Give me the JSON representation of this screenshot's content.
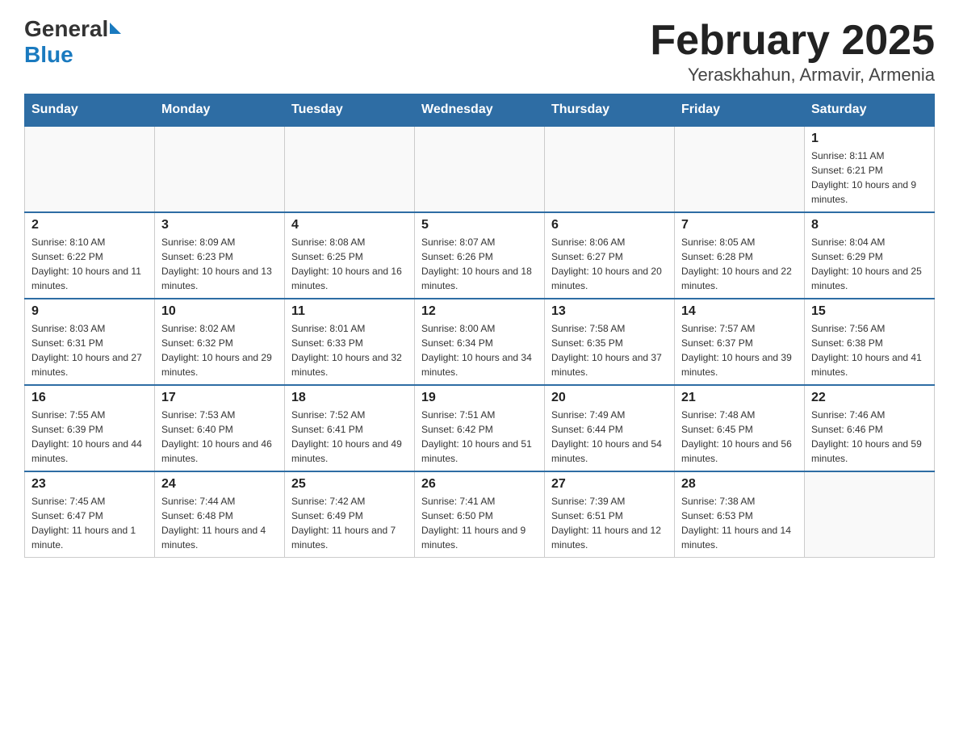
{
  "logo": {
    "general": "General",
    "blue": "Blue"
  },
  "title": "February 2025",
  "location": "Yeraskhahun, Armavir, Armenia",
  "days_of_week": [
    "Sunday",
    "Monday",
    "Tuesday",
    "Wednesday",
    "Thursday",
    "Friday",
    "Saturday"
  ],
  "weeks": [
    [
      {
        "day": "",
        "info": ""
      },
      {
        "day": "",
        "info": ""
      },
      {
        "day": "",
        "info": ""
      },
      {
        "day": "",
        "info": ""
      },
      {
        "day": "",
        "info": ""
      },
      {
        "day": "",
        "info": ""
      },
      {
        "day": "1",
        "info": "Sunrise: 8:11 AM\nSunset: 6:21 PM\nDaylight: 10 hours and 9 minutes."
      }
    ],
    [
      {
        "day": "2",
        "info": "Sunrise: 8:10 AM\nSunset: 6:22 PM\nDaylight: 10 hours and 11 minutes."
      },
      {
        "day": "3",
        "info": "Sunrise: 8:09 AM\nSunset: 6:23 PM\nDaylight: 10 hours and 13 minutes."
      },
      {
        "day": "4",
        "info": "Sunrise: 8:08 AM\nSunset: 6:25 PM\nDaylight: 10 hours and 16 minutes."
      },
      {
        "day": "5",
        "info": "Sunrise: 8:07 AM\nSunset: 6:26 PM\nDaylight: 10 hours and 18 minutes."
      },
      {
        "day": "6",
        "info": "Sunrise: 8:06 AM\nSunset: 6:27 PM\nDaylight: 10 hours and 20 minutes."
      },
      {
        "day": "7",
        "info": "Sunrise: 8:05 AM\nSunset: 6:28 PM\nDaylight: 10 hours and 22 minutes."
      },
      {
        "day": "8",
        "info": "Sunrise: 8:04 AM\nSunset: 6:29 PM\nDaylight: 10 hours and 25 minutes."
      }
    ],
    [
      {
        "day": "9",
        "info": "Sunrise: 8:03 AM\nSunset: 6:31 PM\nDaylight: 10 hours and 27 minutes."
      },
      {
        "day": "10",
        "info": "Sunrise: 8:02 AM\nSunset: 6:32 PM\nDaylight: 10 hours and 29 minutes."
      },
      {
        "day": "11",
        "info": "Sunrise: 8:01 AM\nSunset: 6:33 PM\nDaylight: 10 hours and 32 minutes."
      },
      {
        "day": "12",
        "info": "Sunrise: 8:00 AM\nSunset: 6:34 PM\nDaylight: 10 hours and 34 minutes."
      },
      {
        "day": "13",
        "info": "Sunrise: 7:58 AM\nSunset: 6:35 PM\nDaylight: 10 hours and 37 minutes."
      },
      {
        "day": "14",
        "info": "Sunrise: 7:57 AM\nSunset: 6:37 PM\nDaylight: 10 hours and 39 minutes."
      },
      {
        "day": "15",
        "info": "Sunrise: 7:56 AM\nSunset: 6:38 PM\nDaylight: 10 hours and 41 minutes."
      }
    ],
    [
      {
        "day": "16",
        "info": "Sunrise: 7:55 AM\nSunset: 6:39 PM\nDaylight: 10 hours and 44 minutes."
      },
      {
        "day": "17",
        "info": "Sunrise: 7:53 AM\nSunset: 6:40 PM\nDaylight: 10 hours and 46 minutes."
      },
      {
        "day": "18",
        "info": "Sunrise: 7:52 AM\nSunset: 6:41 PM\nDaylight: 10 hours and 49 minutes."
      },
      {
        "day": "19",
        "info": "Sunrise: 7:51 AM\nSunset: 6:42 PM\nDaylight: 10 hours and 51 minutes."
      },
      {
        "day": "20",
        "info": "Sunrise: 7:49 AM\nSunset: 6:44 PM\nDaylight: 10 hours and 54 minutes."
      },
      {
        "day": "21",
        "info": "Sunrise: 7:48 AM\nSunset: 6:45 PM\nDaylight: 10 hours and 56 minutes."
      },
      {
        "day": "22",
        "info": "Sunrise: 7:46 AM\nSunset: 6:46 PM\nDaylight: 10 hours and 59 minutes."
      }
    ],
    [
      {
        "day": "23",
        "info": "Sunrise: 7:45 AM\nSunset: 6:47 PM\nDaylight: 11 hours and 1 minute."
      },
      {
        "day": "24",
        "info": "Sunrise: 7:44 AM\nSunset: 6:48 PM\nDaylight: 11 hours and 4 minutes."
      },
      {
        "day": "25",
        "info": "Sunrise: 7:42 AM\nSunset: 6:49 PM\nDaylight: 11 hours and 7 minutes."
      },
      {
        "day": "26",
        "info": "Sunrise: 7:41 AM\nSunset: 6:50 PM\nDaylight: 11 hours and 9 minutes."
      },
      {
        "day": "27",
        "info": "Sunrise: 7:39 AM\nSunset: 6:51 PM\nDaylight: 11 hours and 12 minutes."
      },
      {
        "day": "28",
        "info": "Sunrise: 7:38 AM\nSunset: 6:53 PM\nDaylight: 11 hours and 14 minutes."
      },
      {
        "day": "",
        "info": ""
      }
    ]
  ]
}
